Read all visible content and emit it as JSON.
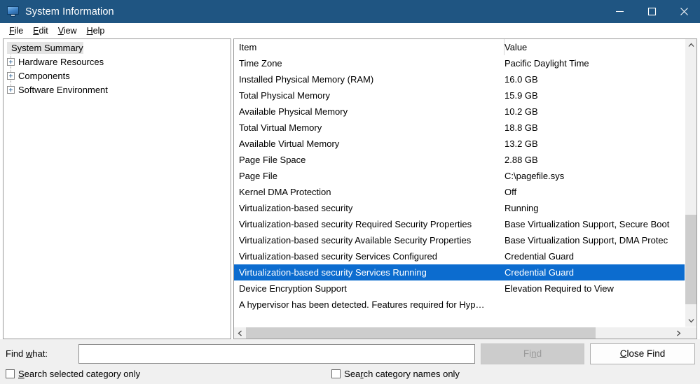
{
  "window": {
    "title": "System Information",
    "icon": "computer-monitor-icon",
    "titlebar_color": "#1f5582",
    "accent_color": "#0c6ccf",
    "controls": {
      "minimize": "minimize-icon",
      "maximize": "maximize-icon",
      "close": "close-icon"
    }
  },
  "menubar": {
    "items": [
      {
        "label": "File",
        "accel": "F"
      },
      {
        "label": "Edit",
        "accel": "E"
      },
      {
        "label": "View",
        "accel": "V"
      },
      {
        "label": "Help",
        "accel": "H"
      }
    ]
  },
  "tree": {
    "root": "System Summary",
    "nodes": [
      {
        "label": "Hardware Resources",
        "expander": "plus-expander-icon"
      },
      {
        "label": "Components",
        "expander": "plus-expander-icon"
      },
      {
        "label": "Software Environment",
        "expander": "plus-expander-icon"
      }
    ]
  },
  "list": {
    "columns": {
      "item": "Item",
      "value": "Value"
    },
    "rows": [
      {
        "item": "Time Zone",
        "value": "Pacific Daylight Time"
      },
      {
        "item": "Installed Physical Memory (RAM)",
        "value": "16.0 GB"
      },
      {
        "item": "Total Physical Memory",
        "value": "15.9 GB"
      },
      {
        "item": "Available Physical Memory",
        "value": "10.2 GB"
      },
      {
        "item": "Total Virtual Memory",
        "value": "18.8 GB"
      },
      {
        "item": "Available Virtual Memory",
        "value": "13.2 GB"
      },
      {
        "item": "Page File Space",
        "value": "2.88 GB"
      },
      {
        "item": "Page File",
        "value": "C:\\pagefile.sys"
      },
      {
        "item": "Kernel DMA Protection",
        "value": "Off"
      },
      {
        "item": "Virtualization-based security",
        "value": "Running"
      },
      {
        "item": "Virtualization-based security Required Security Properties",
        "value": "Base Virtualization Support, Secure Boot"
      },
      {
        "item": "Virtualization-based security Available Security Properties",
        "value": "Base Virtualization Support, DMA Protec"
      },
      {
        "item": "Virtualization-based security Services Configured",
        "value": "Credential Guard"
      },
      {
        "item": "Virtualization-based security Services Running",
        "value": "Credential Guard",
        "selected": true
      },
      {
        "item": "Device Encryption Support",
        "value": "Elevation Required to View"
      },
      {
        "item": "A hypervisor has been detected. Features required for Hyp…",
        "value": "",
        "wide": true
      }
    ]
  },
  "scrollbars": {
    "vertical": {
      "up": "chevron-up-icon",
      "down": "chevron-down-icon"
    },
    "horizontal": {
      "left": "chevron-left-icon",
      "right": "chevron-right-icon"
    }
  },
  "find": {
    "label_pre": "Find ",
    "label_accel": "w",
    "label_post": "hat:",
    "input_value": "",
    "input_placeholder": "",
    "find_button": {
      "pre": "Fi",
      "accel": "n",
      "post": "d",
      "enabled": false
    },
    "close_button": {
      "pre": "",
      "accel": "C",
      "post": "lose Find",
      "enabled": true
    },
    "checkboxes": [
      {
        "pre": "",
        "accel": "S",
        "post": "earch selected category only",
        "checked": false
      },
      {
        "pre": "Sea",
        "accel": "r",
        "post": "ch category names only",
        "checked": false
      }
    ]
  }
}
